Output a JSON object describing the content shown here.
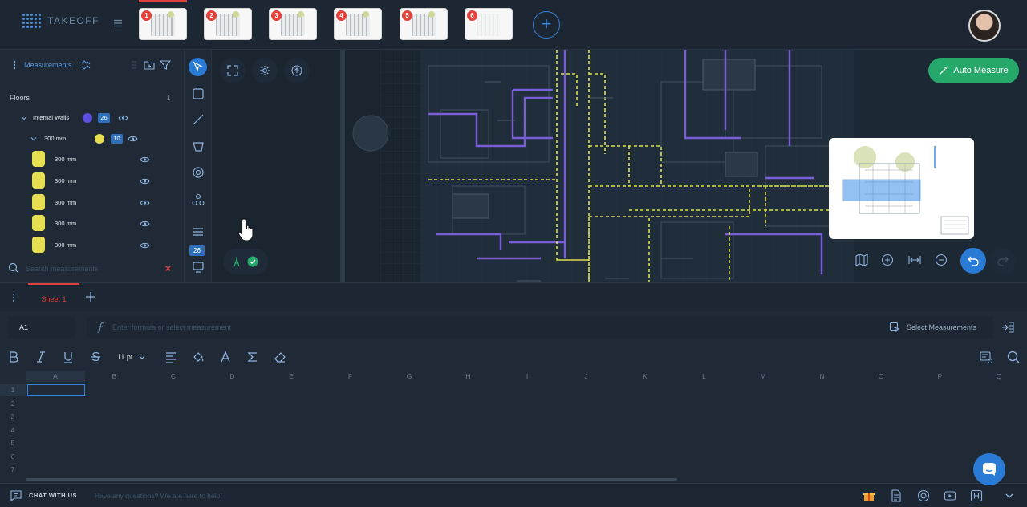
{
  "app": {
    "logo_text": "TAKEOFF"
  },
  "pages": [
    {
      "number": "1",
      "active": true
    },
    {
      "number": "2",
      "active": false
    },
    {
      "number": "3",
      "active": false
    },
    {
      "number": "4",
      "active": false
    },
    {
      "number": "5",
      "active": false
    },
    {
      "number": "6",
      "active": false
    }
  ],
  "measurements": {
    "title": "Measurements",
    "group_label": "Floors",
    "group_count": "1",
    "category": {
      "label": "Internal Walls",
      "color": "#5b4fe0",
      "count": "26"
    },
    "subcategory": {
      "label": "300 mm",
      "color": "#e6df52",
      "count": "10"
    },
    "items": [
      {
        "label": "300 mm"
      },
      {
        "label": "300 mm"
      },
      {
        "label": "300 mm"
      },
      {
        "label": "300 mm"
      },
      {
        "label": "300 mm"
      }
    ],
    "search_placeholder": "Search measurements"
  },
  "tools": {
    "count_badge": "26"
  },
  "canvas": {
    "auto_measure_label": "Auto Measure"
  },
  "sheets": {
    "tabs": [
      {
        "label": "Sheet 1"
      }
    ]
  },
  "formula_bar": {
    "cell_ref": "A1",
    "placeholder": "Enter formula or select measurement",
    "select_measurements_label": "Select Measurements"
  },
  "toolbar": {
    "font_size": "11 pt"
  },
  "grid": {
    "columns": [
      "A",
      "B",
      "C",
      "D",
      "E",
      "F",
      "G",
      "H",
      "I",
      "J",
      "K",
      "L",
      "M",
      "N",
      "O",
      "P",
      "Q"
    ],
    "rows": [
      "1",
      "2",
      "3",
      "4",
      "5",
      "6",
      "7"
    ]
  },
  "chat": {
    "title": "CHAT WITH US",
    "message": "Have any questions? We are here to help!"
  },
  "colors": {
    "accent": "#2a7bd6",
    "danger": "#e0413a",
    "success": "#27a86b"
  }
}
